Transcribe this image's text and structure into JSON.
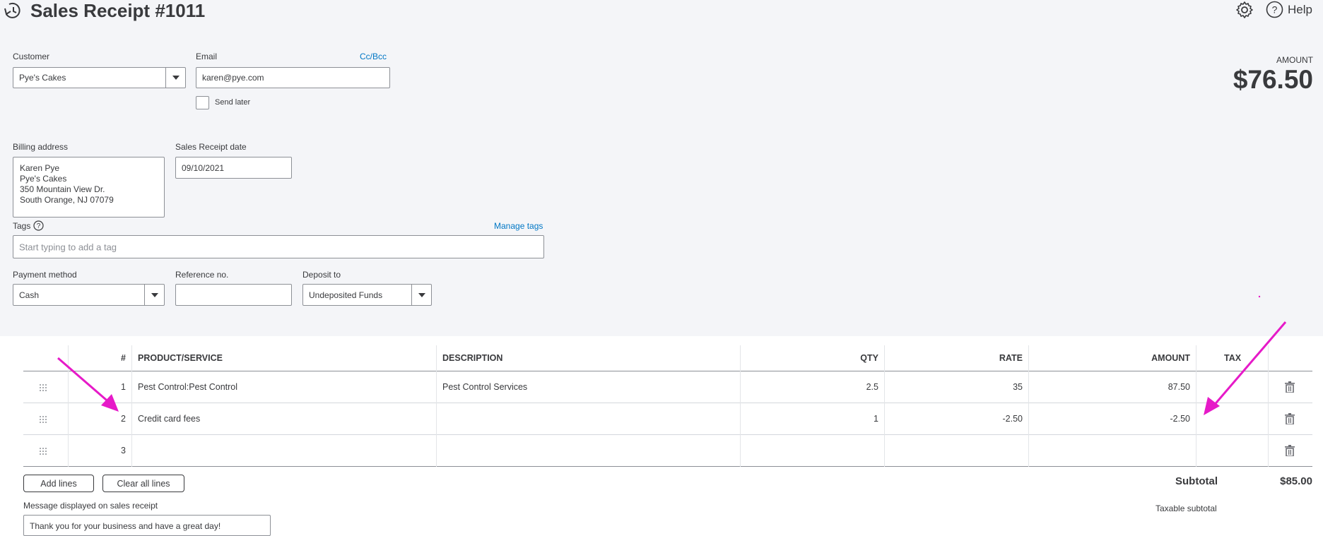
{
  "header": {
    "title": "Sales Receipt #1011",
    "help_label": "Help"
  },
  "amount": {
    "label": "AMOUNT",
    "value": "$76.50"
  },
  "customer": {
    "label": "Customer",
    "value": "Pye's Cakes"
  },
  "email": {
    "label": "Email",
    "value": "karen@pye.com",
    "cc_bcc_label": "Cc/Bcc",
    "send_later_label": "Send later"
  },
  "billing": {
    "label": "Billing address",
    "lines": [
      "Karen Pye",
      "Pye's Cakes",
      "350 Mountain View Dr.",
      "South Orange, NJ  07079"
    ]
  },
  "receipt_date": {
    "label": "Sales Receipt date",
    "value": "09/10/2021"
  },
  "tags": {
    "label": "Tags",
    "manage_label": "Manage tags",
    "placeholder": "Start typing to add a tag"
  },
  "payment": {
    "method_label": "Payment method",
    "method_value": "Cash",
    "reference_label": "Reference no.",
    "reference_value": "",
    "deposit_label": "Deposit to",
    "deposit_value": "Undeposited Funds"
  },
  "table": {
    "headers": {
      "num": "#",
      "product": "PRODUCT/SERVICE",
      "description": "DESCRIPTION",
      "qty": "QTY",
      "rate": "RATE",
      "amount": "AMOUNT",
      "tax": "TAX"
    },
    "rows": [
      {
        "num": "1",
        "product": "Pest Control:Pest Control",
        "description": "Pest Control Services",
        "qty": "2.5",
        "rate": "35",
        "amount": "87.50"
      },
      {
        "num": "2",
        "product": "Credit card fees",
        "description": "",
        "qty": "1",
        "rate": "-2.50",
        "amount": "-2.50"
      },
      {
        "num": "3",
        "product": "",
        "description": "",
        "qty": "",
        "rate": "",
        "amount": ""
      }
    ]
  },
  "actions": {
    "add_lines": "Add lines",
    "clear_all_lines": "Clear all lines"
  },
  "totals": {
    "subtotal_label": "Subtotal",
    "subtotal_value": "$85.00",
    "taxable_subtotal_label": "Taxable subtotal"
  },
  "message": {
    "label": "Message displayed on sales receipt",
    "value": "Thank you for your business and have a great day!"
  },
  "colors": {
    "panel_bg": "#f4f5f8",
    "link": "#0077c5",
    "annotation_arrow": "#e61ac8"
  }
}
